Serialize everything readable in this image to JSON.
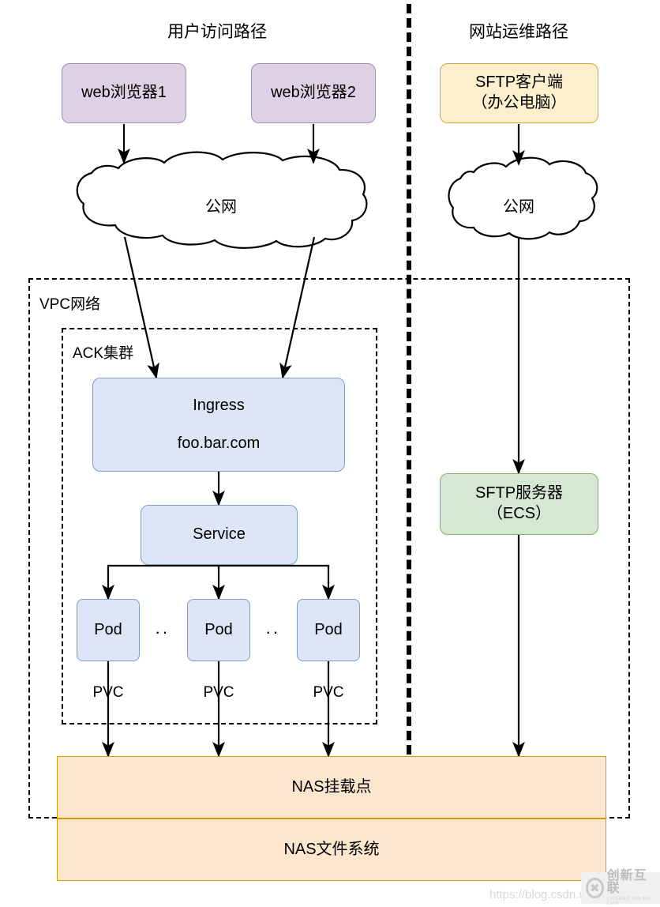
{
  "diagram": {
    "lanes": [
      {
        "title": "用户访问路径"
      },
      {
        "title": "网站运维路径"
      }
    ],
    "groups": [
      {
        "label": "VPC网络"
      },
      {
        "label": "ACK集群"
      }
    ],
    "nodes": {
      "browser1": {
        "label": "web浏览器1"
      },
      "browser2": {
        "label": "web浏览器2"
      },
      "sftp_client": {
        "line1": "SFTP客户端",
        "line2": "（办公电脑）"
      },
      "public_net_left": {
        "label": "公网"
      },
      "public_net_right": {
        "label": "公网"
      },
      "ingress": {
        "line1": "Ingress",
        "line2": "foo.bar.com"
      },
      "service": {
        "label": "Service"
      },
      "pod1": {
        "label": "Pod"
      },
      "pod2": {
        "label": "Pod"
      },
      "pod3": {
        "label": "Pod"
      },
      "sftp_server": {
        "line1": "SFTP服务器",
        "line2": "（ECS）"
      },
      "nas_mount": {
        "label": "NAS挂载点"
      },
      "nas_filesystem": {
        "label": "NAS文件系统"
      }
    },
    "edge_labels": {
      "pvc1": "PVC",
      "pvc2": "PVC",
      "pvc3": "PVC"
    },
    "separators": {
      "pod_ellipsis_1": "··",
      "pod_ellipsis_2": "··"
    },
    "colors": {
      "browser_fill": "#dfd1e5",
      "browser_stroke": "#9f8fae",
      "sftp_client_fill": "#fbefcd",
      "sftp_client_stroke": "#d0a93a",
      "sftp_server_fill": "#d5e8d4",
      "sftp_server_stroke": "#82b366",
      "k8s_fill": "#dce6f6",
      "k8s_stroke": "#7f9dc8",
      "nas_fill": "#fce6cd",
      "nas_stroke": "#d79b00",
      "line": "#000000"
    }
  },
  "watermark": {
    "url": "https://blog.csdn.n",
    "brand_cn": "创新互联",
    "brand_en": "CHUANG XIN HU LIAN",
    "logo_glyph": "✖"
  }
}
